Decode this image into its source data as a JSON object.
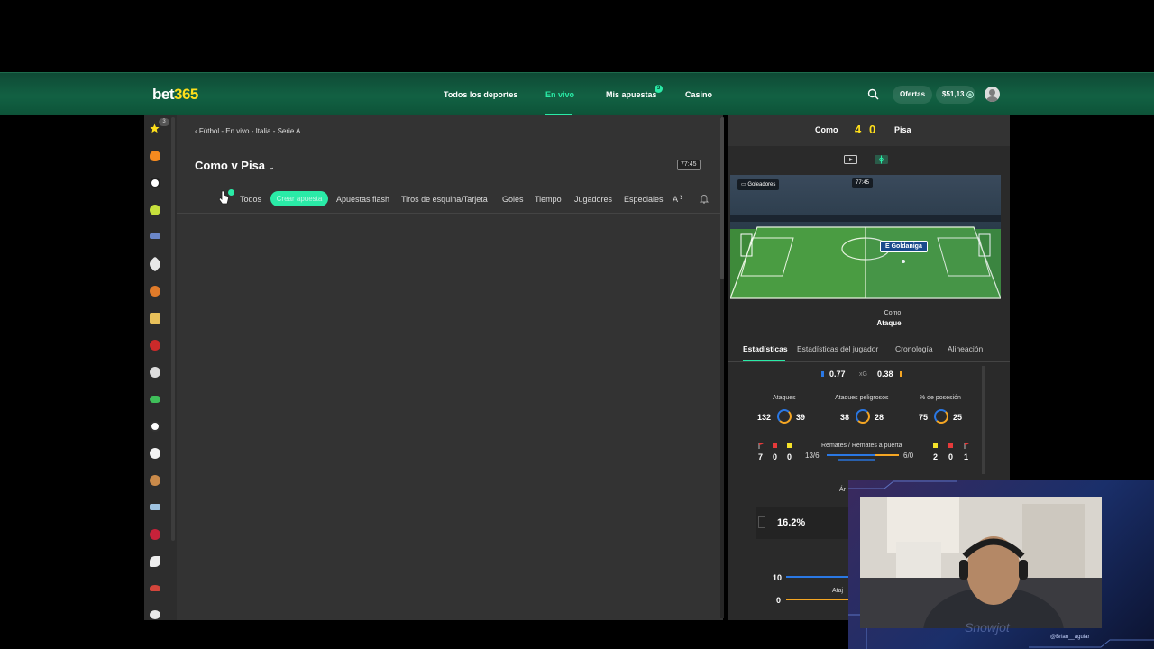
{
  "header": {
    "logo_main": "bet",
    "logo_num": "365",
    "nav": [
      "Todos los deportes",
      "En vivo",
      "Mis apuestas",
      "Casino"
    ],
    "bets_badge": "3",
    "offers_label": "Ofertas",
    "balance": "$51,13"
  },
  "sidebar": {
    "favorites_count": "3"
  },
  "main": {
    "breadcrumb": "Fútbol - En vivo - Italia - Serie A",
    "match_title": "Como v Pisa",
    "clock": "77:45",
    "tabs": [
      "Todos",
      "Crear apuesta",
      "Apuestas flash",
      "Tiros de esquina/Tarjeta",
      "Goles",
      "Tiempo",
      "Jugadores",
      "Especiales",
      "A"
    ]
  },
  "scoreboard": {
    "home_team": "Como",
    "away_team": "Pisa",
    "home_score": "4",
    "away_score": "0",
    "pitch_label": "Goleadores",
    "pitch_clock": "77:45",
    "player_name": "E Goldaniga",
    "attack_team": "Como",
    "attack_label": "Ataque"
  },
  "stats_tabs": [
    "Estadísticas",
    "Estadísticas del jugador",
    "Cronología",
    "Alineación"
  ],
  "stats": {
    "xg_home": "0.77",
    "xg_label": "xG",
    "xg_away": "0.38",
    "attacks_label": "Ataques",
    "attacks_home": "132",
    "attacks_away": "39",
    "danger_label": "Ataques peligrosos",
    "danger_home": "38",
    "danger_away": "28",
    "possession_label": "% de posesión",
    "possession_home": "75",
    "possession_away": "25",
    "shots_label": "Remates / Remates a puerta",
    "shots_home": "13/6",
    "shots_away": "6/0",
    "home_corners": "7",
    "home_red": "0",
    "home_yellow": "0",
    "away_yellow": "2",
    "away_red": "0",
    "away_corners": "1",
    "possession_pct": "16.2%",
    "lower_value_1": "10",
    "lower_value_2": "0",
    "lower_label": "Ataj",
    "lower_label_2": "Ár"
  },
  "webcam": {
    "handle": "@Brian__aguiar",
    "brand": "Snowjot"
  },
  "colors": {
    "accent": "#2aeba7",
    "score_yellow": "#ffdf1b",
    "home_blue": "#2a78e4",
    "away_orange": "#f5a623"
  }
}
